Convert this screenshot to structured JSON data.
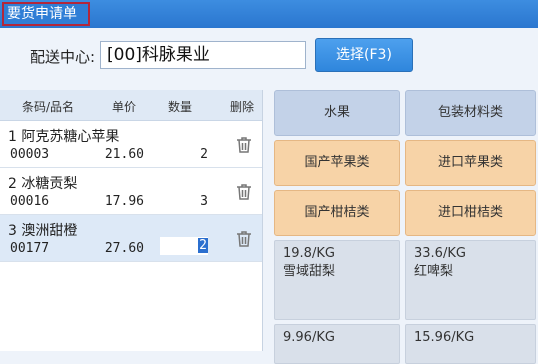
{
  "window": {
    "title": "要货申请单"
  },
  "distribution": {
    "label": "配送中心:",
    "value": "[00]科脉果业",
    "select_label": "选择(F3)"
  },
  "list": {
    "headers": {
      "code_name": "条码/品名",
      "price": "单价",
      "qty": "数量",
      "delete": "删除"
    },
    "rows": [
      {
        "index": "1",
        "name": "阿克苏糖心苹果",
        "code": "00003",
        "price": "21.60",
        "qty": "2"
      },
      {
        "index": "2",
        "name": "冰糖贡梨",
        "code": "00016",
        "price": "17.96",
        "qty": "3"
      },
      {
        "index": "3",
        "name": "澳洲甜橙",
        "code": "00177",
        "price": "27.60",
        "qty": "2"
      }
    ],
    "selected_row": 3
  },
  "categories": {
    "main": [
      "水果",
      "包装材料类"
    ],
    "sub": [
      "国产苹果类",
      "进口苹果类",
      "国产柑桔类",
      "进口柑桔类"
    ]
  },
  "products": [
    {
      "price": "19.8/KG",
      "name": "雪域甜梨"
    },
    {
      "price": "33.6/KG",
      "name": "红啤梨"
    },
    {
      "price": "9.96/KG",
      "name": ""
    },
    {
      "price": "15.96/KG",
      "name": ""
    }
  ],
  "colors": {
    "titlebar": "#2a76cf",
    "select_button": "#2f86dc",
    "category_main": "#c3d2e8",
    "category_sub": "#f7d3a7",
    "highlight_border": "#b3263a"
  },
  "icons": {
    "delete": "trash-icon"
  }
}
